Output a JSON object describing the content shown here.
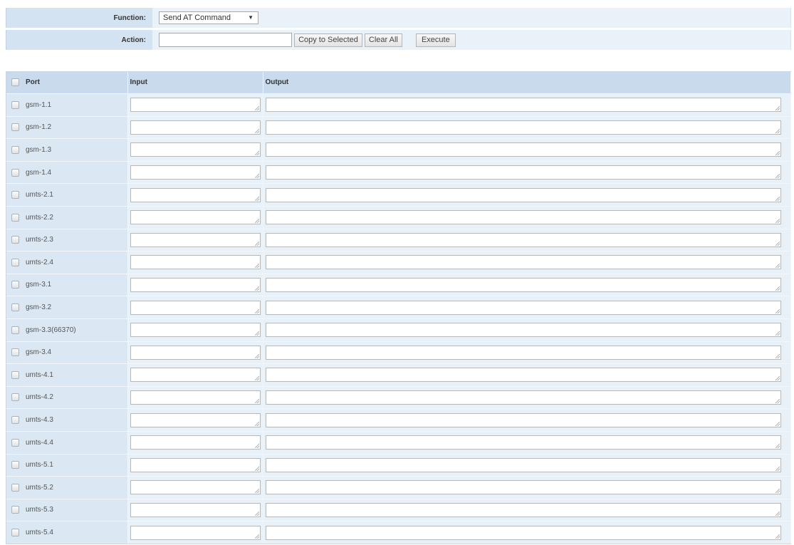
{
  "form": {
    "function_label": "Function:",
    "function_value": "Send AT Command",
    "action_label": "Action:",
    "action_value": "",
    "copy_button": "Copy to Selected",
    "clear_button": "Clear All",
    "execute_button": "Execute"
  },
  "table": {
    "headers": {
      "port": "Port",
      "input": "Input",
      "output": "Output"
    },
    "rows": [
      {
        "port": "gsm-1.1",
        "input": "",
        "output": ""
      },
      {
        "port": "gsm-1.2",
        "input": "",
        "output": ""
      },
      {
        "port": "gsm-1.3",
        "input": "",
        "output": ""
      },
      {
        "port": "gsm-1.4",
        "input": "",
        "output": ""
      },
      {
        "port": "umts-2.1",
        "input": "",
        "output": ""
      },
      {
        "port": "umts-2.2",
        "input": "",
        "output": ""
      },
      {
        "port": "umts-2.3",
        "input": "",
        "output": ""
      },
      {
        "port": "umts-2.4",
        "input": "",
        "output": ""
      },
      {
        "port": "gsm-3.1",
        "input": "",
        "output": ""
      },
      {
        "port": "gsm-3.2",
        "input": "",
        "output": ""
      },
      {
        "port": "gsm-3.3(66370)",
        "input": "",
        "output": ""
      },
      {
        "port": "gsm-3.4",
        "input": "",
        "output": ""
      },
      {
        "port": "umts-4.1",
        "input": "",
        "output": ""
      },
      {
        "port": "umts-4.2",
        "input": "",
        "output": ""
      },
      {
        "port": "umts-4.3",
        "input": "",
        "output": ""
      },
      {
        "port": "umts-4.4",
        "input": "",
        "output": ""
      },
      {
        "port": "umts-5.1",
        "input": "",
        "output": ""
      },
      {
        "port": "umts-5.2",
        "input": "",
        "output": ""
      },
      {
        "port": "umts-5.3",
        "input": "",
        "output": ""
      },
      {
        "port": "umts-5.4",
        "input": "",
        "output": ""
      }
    ]
  },
  "icons": {
    "select_arrow": "chevron-down-icon",
    "resize_grip": "resize-grip-icon"
  },
  "colors": {
    "label_bg": "#d4e3f2",
    "value_bg": "#e9f1f9",
    "header_bg": "#c8daec",
    "port_cell_bg": "#dbe7f3"
  }
}
